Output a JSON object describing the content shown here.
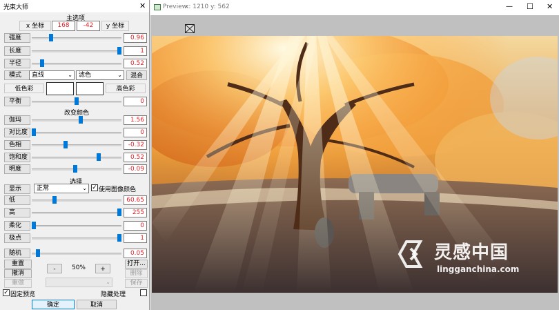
{
  "left_window": {
    "title": "光束大师",
    "section_main": "主选项",
    "x_coord_label": "x 坐标",
    "y_coord_label": "y 坐标",
    "x_value": "168",
    "y_value": "-42",
    "sliders_top": [
      {
        "label": "强度",
        "value": "0.96",
        "level": 0.2
      },
      {
        "label": "长度",
        "value": "1",
        "level": 1.0
      },
      {
        "label": "半径",
        "value": "0.52",
        "level": 0.1
      }
    ],
    "mode_label": "模式",
    "mode_select": "直线",
    "blend_select": "滤色",
    "blend_button": "混合",
    "low_color_label": "低色彩",
    "high_color_label": "高色彩",
    "balance": {
      "label": "平衡",
      "value": "0",
      "level": 0.5
    },
    "section_color": "改变颜色",
    "sliders_color": [
      {
        "label": "伽玛",
        "value": "1.56",
        "level": 0.55
      },
      {
        "label": "对比度",
        "value": "0",
        "level": 0.0
      },
      {
        "label": "色相",
        "value": "-0.32",
        "level": 0.37
      },
      {
        "label": "饱和度",
        "value": "0.52",
        "level": 0.76
      },
      {
        "label": "明度",
        "value": "-0.09",
        "level": 0.48
      }
    ],
    "section_select": "选择",
    "display_label": "显示",
    "display_select": "正常",
    "use_image_color_label": "使用图像颜色",
    "use_image_color_checked": true,
    "sliders_select": [
      {
        "label": "低",
        "value": "60.65",
        "level": 0.24
      },
      {
        "label": "高",
        "value": "255",
        "level": 1.0
      },
      {
        "label": "柔化",
        "value": "0",
        "level": 0.0
      },
      {
        "label": "极点",
        "value": "1",
        "level": 1.0
      }
    ],
    "random": {
      "label": "随机",
      "value": "0.05",
      "level": 0.05
    },
    "reset_label": "重置",
    "undo_label": "撤消",
    "redo_label": "重做",
    "zoom_minus": "-",
    "zoom_value": "50%",
    "zoom_plus": "+",
    "open_label": "打开...",
    "delete_label": "删除",
    "save_label": "保存",
    "fixed_preview_label": "固定预览",
    "fixed_preview_checked": true,
    "hide_process_label": "隐藏处理",
    "hide_process_checked": false,
    "ok_label": "确定",
    "cancel_label": "取消",
    "close_glyph": "✕"
  },
  "preview_window": {
    "title": "Preview:",
    "coords": "x: 1210 y: 562",
    "minimize_glyph": "—",
    "maximize_glyph": "☐",
    "close_glyph": "✕"
  },
  "watermark": {
    "text_cn": "灵感中国",
    "text_url": "lingganchina.com"
  },
  "colors": {
    "accent": "#0078d7",
    "value_red": "#e0222a",
    "panel_bg": "#f0f0f0",
    "preview_bg": "#c0c0c0"
  }
}
